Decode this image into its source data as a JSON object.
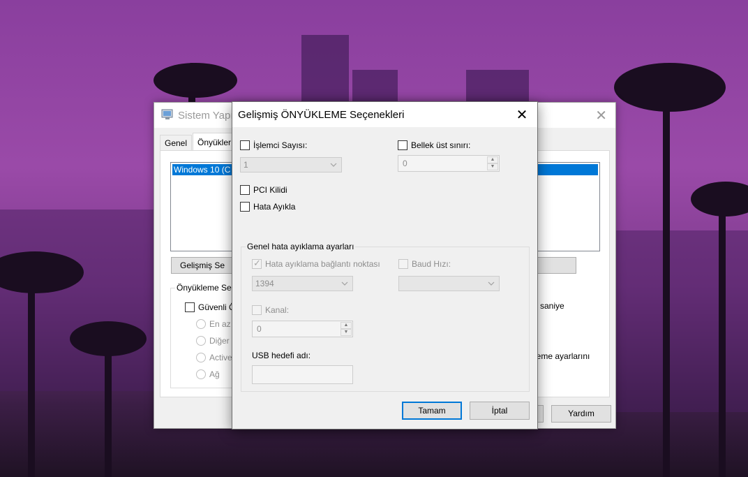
{
  "background_window": {
    "title": "Sistem Yapı",
    "tabs": [
      "Genel",
      "Önyükler"
    ],
    "os_entry": "Windows 10 (C",
    "advanced_button": "Gelişmiş Se",
    "boot_options_group": "Önyükleme Se",
    "safe_boot_label": "Güvenli Ö",
    "radio_options": [
      "En az",
      "Diğer",
      "Active",
      "Ağ"
    ],
    "right_text_1": "saniye",
    "right_text_2": "leme ayarlarını",
    "help_button": "Yardım"
  },
  "dialog": {
    "title": "Gelişmiş ÖNYÜKLEME Seçenekleri",
    "close_glyph": "✕",
    "processor_count_label": "İşlemci Sayısı:",
    "processor_count_value": "1",
    "max_memory_label": "Bellek üst sınırı:",
    "max_memory_value": "0",
    "pci_lock_label": "PCI Kilidi",
    "debug_label": "Hata Ayıkla",
    "debug_group_title": "Genel hata ayıklama ayarları",
    "debug_port_label": "Hata ayıklama bağlantı noktası",
    "debug_port_value": "1394",
    "baud_rate_label": "Baud Hızı:",
    "baud_rate_value": "",
    "channel_label": "Kanal:",
    "channel_value": "0",
    "usb_target_label": "USB hedefi adı:",
    "usb_target_value": "",
    "ok_button": "Tamam",
    "cancel_button": "İptal"
  },
  "icons": {
    "dropdown": "chevron-down-icon",
    "spin_up": "spin-up-icon",
    "spin_down": "spin-down-icon"
  },
  "colors": {
    "accent": "#0078d7",
    "wallpaper": "#8a3f9e"
  }
}
